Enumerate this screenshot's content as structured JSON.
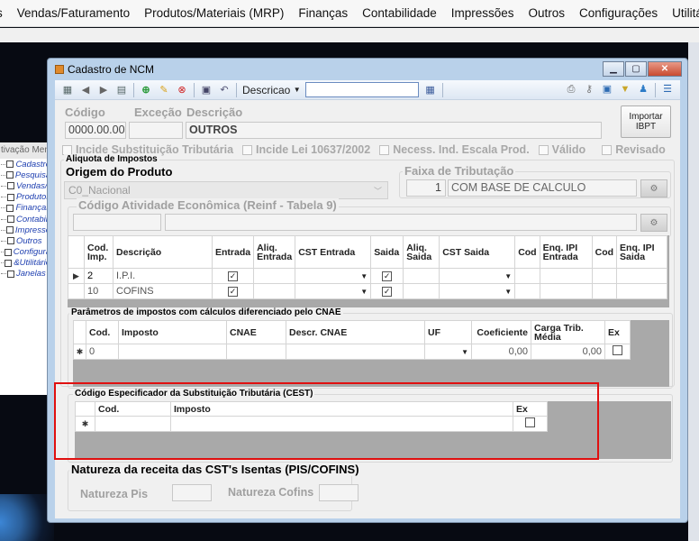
{
  "menubar": [
    "s",
    "Vendas/Faturamento",
    "Produtos/Materiais (MRP)",
    "Finanças",
    "Contabilidade",
    "Impressões",
    "Outros",
    "Configurações",
    "Utilitá"
  ],
  "tree": {
    "header": "tivação Men",
    "items": [
      "Cadastro",
      "Pesquisa",
      "Vendas/",
      "Produtos",
      "Finanças",
      "Contabili",
      "Impresso",
      "Outros",
      "Configura",
      "&Utilitário",
      "Janelas"
    ]
  },
  "window": {
    "title": "Cadastro de NCM",
    "toolbar": {
      "search_field_label": "Descricao"
    },
    "form": {
      "codigo_label": "Código",
      "excecao_label": "Exceção",
      "descricao_label": "Descrição",
      "codigo_value": "0000.00.00",
      "excecao_value": "",
      "descricao_value": "OUTROS",
      "ibpt_button": "Importar IBPT",
      "checks": [
        "Incide Substituição Tributária",
        "Incide Lei 10637/2002",
        "Necess. Ind. Escala Prod.",
        "Válido",
        "Revisado"
      ]
    },
    "aliquota_group": "Aliquota de Impostos",
    "origem": {
      "label": "Origem do Produto",
      "value": "C0_Nacional"
    },
    "faixa": {
      "label": "Faixa de Tributação",
      "code": "1",
      "value": "COM BASE DE CALCULO"
    },
    "reinf_label": "Código Atividade Econômica (Reinf - Tabela 9)",
    "impostos_grid": {
      "headers": [
        "Cod. Imp.",
        "Descrição",
        "Entrada",
        "Aliq. Entrada",
        "CST Entrada",
        "Saida",
        "Aliq. Saida",
        "CST Saida",
        "Cod",
        "Enq. IPI Entrada",
        "Cod",
        "Enq. IPI Saida"
      ],
      "rows": [
        {
          "cod": "2",
          "desc": "I.P.I."
        },
        {
          "cod": "10",
          "desc": "COFINS"
        }
      ]
    },
    "cnae_section": {
      "title": "Parâmetros de impostos com cálculos diferenciado pelo CNAE",
      "headers": [
        "Cod.",
        "Imposto",
        "CNAE",
        "Descr. CNAE",
        "UF",
        "Coeficiente",
        "Carga Trib. Média",
        "Ex"
      ],
      "row": {
        "cod": "0",
        "coef": "0,00",
        "carga": "0,00"
      }
    },
    "cest_section": {
      "title": "Código Especificador da Substituição Tributária (CEST)",
      "headers": [
        "Cod.",
        "Imposto",
        "Ex"
      ]
    },
    "natureza_section": {
      "title": "Natureza da receita das CST's Isentas (PIS/COFINS)",
      "pis_label": "Natureza Pis",
      "cofins_label": "Natureza Cofins"
    }
  },
  "colors": {
    "accent_red": "#e01010",
    "window_frame": "#b9d1ea"
  }
}
